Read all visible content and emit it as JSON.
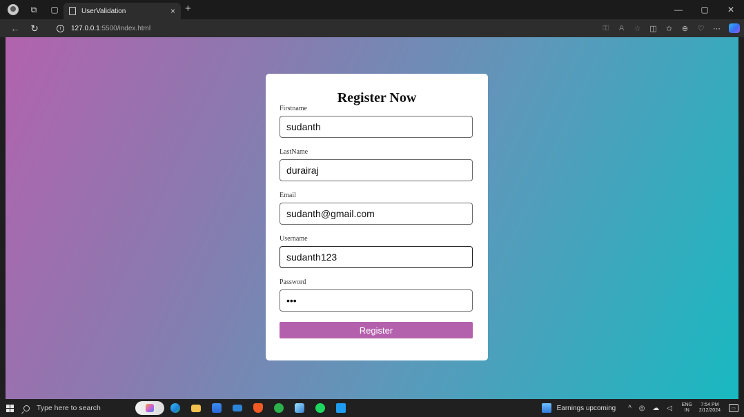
{
  "browser": {
    "tab_title": "UserValidation",
    "tab_close": "×",
    "new_tab": "+",
    "url_host": "127.0.0.1",
    "url_rest": ":5500/index.html"
  },
  "form": {
    "title": "Register Now",
    "fields": [
      {
        "label": "Firstname",
        "value": "sudanth"
      },
      {
        "label": "LastName",
        "value": "durairaj"
      },
      {
        "label": "Email",
        "value": "sudanth@gmail.com"
      },
      {
        "label": "Username",
        "value": "sudanth123"
      },
      {
        "label": "Password",
        "value": "123"
      }
    ],
    "submit_label": "Register"
  },
  "taskbar": {
    "search_placeholder": "Type here to search",
    "news": "Earnings upcoming",
    "lang_top": "ENG",
    "lang_bottom": "IN",
    "time": "7:54 PM",
    "date": "2/12/2024"
  },
  "colors": {
    "gradient_start": "#b263ad",
    "gradient_end": "#19b9c1",
    "button": "#b461ad"
  }
}
